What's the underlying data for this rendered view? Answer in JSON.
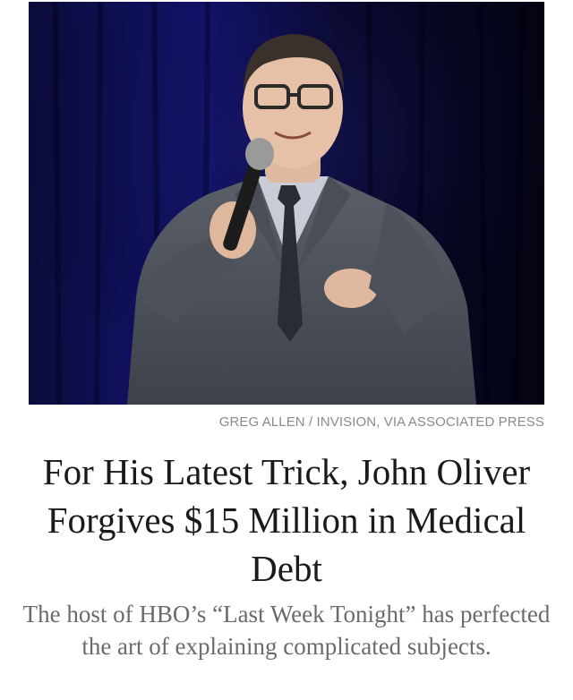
{
  "article": {
    "photo_subject": "man in grey suit with glasses holding a microphone on stage",
    "photo_credit": "GREG ALLEN / INVISION, VIA ASSOCIATED PRESS",
    "headline": "For His Latest Trick, John Oliver Forgives $15 Million in Medical Debt",
    "summary": "The host of HBO’s “Last Week Tonight” has perfected the art of explaining complicated subjects."
  },
  "colors": {
    "background": "#ffffff",
    "headline_text": "#1a1a1a",
    "summary_text": "#6b6b6b",
    "credit_text": "#8a8a8a",
    "photo_backdrop": "#0a0a2a"
  }
}
